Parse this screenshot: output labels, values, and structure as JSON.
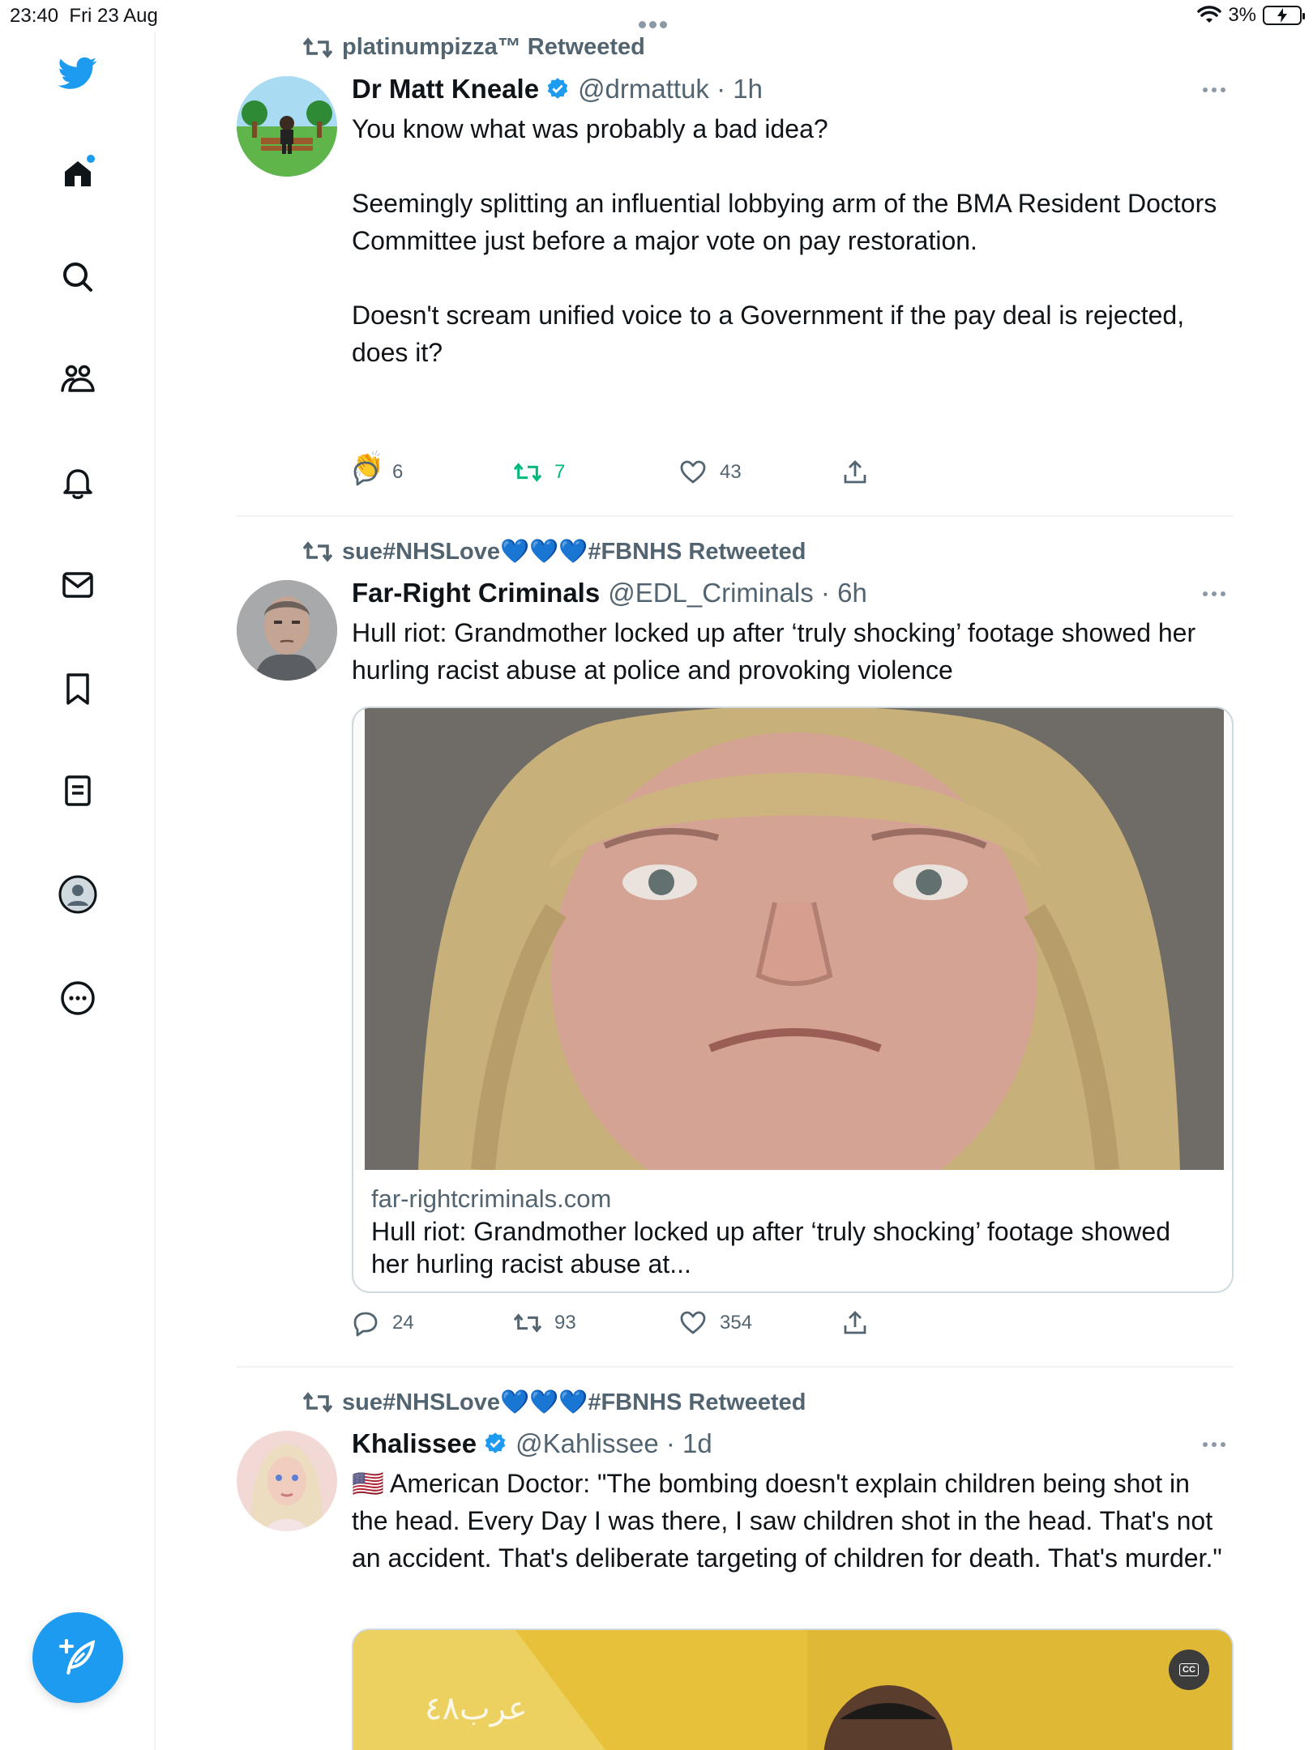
{
  "status_bar": {
    "time": "23:40",
    "date": "Fri 23 Aug",
    "battery": "3%"
  },
  "sidebar": {
    "items": [
      {
        "name": "twitter-logo-icon"
      },
      {
        "name": "home-icon"
      },
      {
        "name": "search-icon"
      },
      {
        "name": "communities-icon"
      },
      {
        "name": "notifications-icon"
      },
      {
        "name": "messages-icon"
      },
      {
        "name": "bookmarks-icon"
      },
      {
        "name": "lists-icon"
      },
      {
        "name": "profile-icon"
      },
      {
        "name": "more-icon"
      }
    ],
    "compose_icon": "compose-tweet-icon"
  },
  "colors": {
    "accent": "#1d9bf0",
    "text": "#0f1419",
    "muted": "#536471",
    "retweet_green": "#00ba7c",
    "border": "#eff3f4"
  },
  "tweets": [
    {
      "retweeted_by": "platinumpizza™ Retweeted",
      "name": "Dr Matt Kneale",
      "verified": true,
      "handle": "@drmattuk · 1h",
      "text": "You know what was probably a bad idea?\n\nSeemingly splitting an influential lobbying arm of the BMA Resident Doctors Committee just before a major vote on pay restoration.\n\nDoesn't scream unified voice to a Government if the pay deal is rejected, does it?\n\n\n👏",
      "replies": "6",
      "retweets": "7",
      "likes": "43"
    },
    {
      "retweeted_by": "sue#NHSLove💙💙💙#FBNHS Retweeted",
      "name": "Far-Right Criminals",
      "verified": false,
      "handle": "@EDL_Criminals · 6h",
      "text": "Hull riot: Grandmother locked up after ‘truly shocking’ footage showed her hurling racist abuse at police and provoking violence",
      "card": {
        "domain": "far-rightcriminals.com",
        "title": "Hull riot: Grandmother locked up after ‘truly shocking’ footage showed her hurling racist abuse at..."
      },
      "replies": "24",
      "retweets": "93",
      "likes": "354"
    },
    {
      "retweeted_by": "sue#NHSLove💙💙💙#FBNHS Retweeted",
      "name": "Khalissee",
      "verified": true,
      "handle": "@Kahlissee · 1d",
      "text": "🇺🇸 American Doctor: \"The bombing doesn't explain children being shot in the head. Every Day I was there, I saw children shot in the head. That's not an accident. That's deliberate targeting of children for death. That's murder.\"",
      "video_caption_badge": "CC"
    }
  ]
}
